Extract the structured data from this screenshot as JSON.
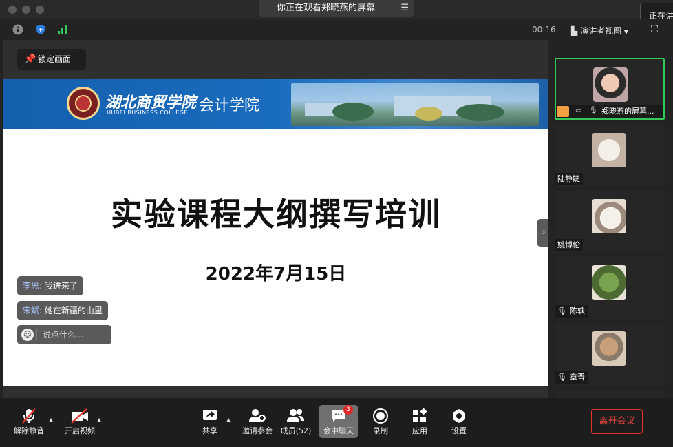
{
  "titlebar": {
    "sharing_banner": "你正在观看郑晓燕的屏幕",
    "menu_icon": "menu-icon",
    "right_tooltip": "正在讲"
  },
  "infobar": {
    "timer": "00:16",
    "view_label": "演讲者视图",
    "icons": [
      "info-icon",
      "shield-icon",
      "signal-icon",
      "fullscreen-icon"
    ]
  },
  "share": {
    "lock_label": "锁定画面",
    "slide": {
      "school_name": "湖北商贸学院",
      "school_en": "HUBEI BUSINESS COLLEGE",
      "college": "会计学院",
      "title": "实验课程大纲撰写培训",
      "date": "2022年7月15日"
    }
  },
  "chat": {
    "messages": [
      {
        "sender": "李思:",
        "text": "我进来了"
      },
      {
        "sender": "宋斌:",
        "text": "她在新疆的山里"
      }
    ],
    "placeholder": "说点什么..."
  },
  "participants": [
    {
      "name": "郑晓燕的屏幕...",
      "active": true,
      "avatar_color": "#c9a48c"
    },
    {
      "name": "陆静婕",
      "active": false,
      "avatar_color": "#d8cbbd"
    },
    {
      "name": "姚博伦",
      "active": false,
      "avatar_color": "#e9ded2"
    },
    {
      "name": "陈轶",
      "active": false,
      "muted": true,
      "avatar_color": "#6b8d4f"
    },
    {
      "name": "章晋",
      "active": false,
      "muted": true,
      "avatar_color": "#d6b79c"
    }
  ],
  "toolbar": {
    "unmute": "解除静音",
    "start_video": "开启视频",
    "share": "共享",
    "invite": "邀请参会",
    "members": "成员(52)",
    "chat": "会中聊天",
    "chat_badge": "3",
    "record": "录制",
    "apps": "应用",
    "settings": "设置",
    "leave": "离开会议"
  },
  "colors": {
    "active_border": "#34c759",
    "leave_red": "#e0342c",
    "slide_header_blue": "#1a6cbf"
  }
}
